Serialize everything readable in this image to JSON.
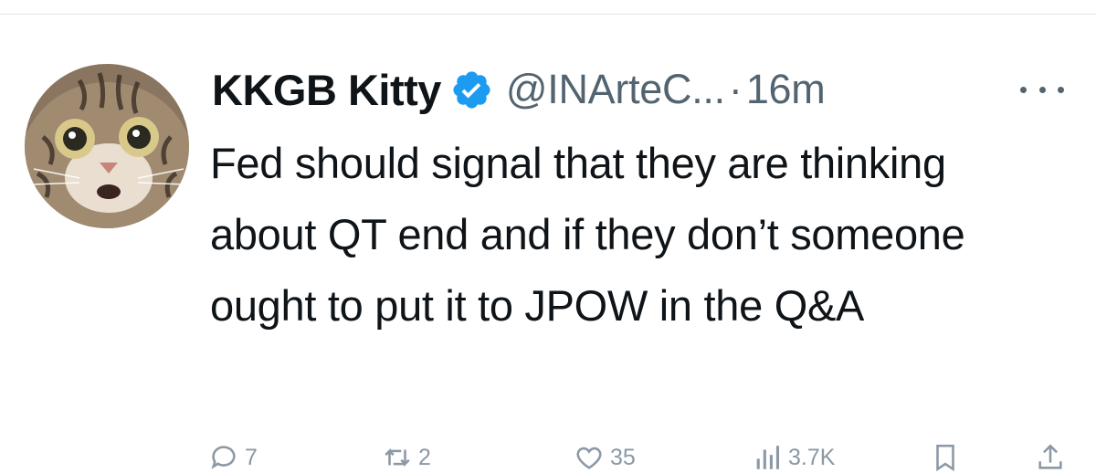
{
  "tweet": {
    "display_name": "KKGB Kitty",
    "handle": "@INArteC...",
    "separator": "·",
    "timestamp": "16m",
    "verified": true,
    "text": "Fed should signal that they are thinking about QT end and if they don’t someone ought to put it to JPOW in the Q&A"
  },
  "actions": {
    "replies": "7",
    "retweets": "2",
    "likes": "35",
    "views": "3.7K"
  },
  "icons": {
    "more": "more-horizontal-icon",
    "verified": "verified-badge-icon",
    "reply": "reply-icon",
    "retweet": "retweet-icon",
    "like": "heart-icon",
    "views": "views-icon",
    "bookmark": "bookmark-icon",
    "share": "share-icon"
  },
  "colors": {
    "verified_badge": "#1d9bf0",
    "text_primary": "#0f1419",
    "text_secondary": "#536471",
    "action_icons": "#8b98a5"
  }
}
